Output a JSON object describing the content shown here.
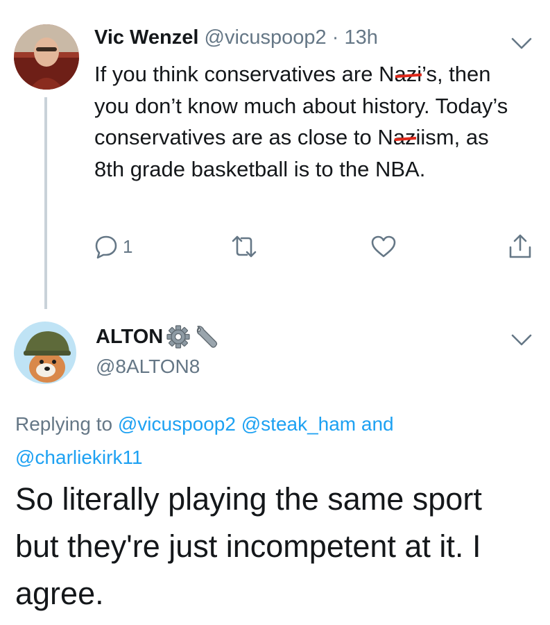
{
  "tweet1": {
    "display_name": "Vic Wenzel",
    "handle": "@vicuspoop2",
    "separator": "·",
    "time": "13h",
    "text_parts": {
      "p1": "If you think conservatives are ",
      "s1": "N",
      "s2": "azi",
      "p2": "’s, then you don’t know much about history. Today’s conservatives are as close to ",
      "s3": "N",
      "s4": "az",
      "p3": "iism, as 8th grade basketball is to the NBA."
    },
    "reply_count": "1"
  },
  "tweet2": {
    "display_name": "ALTON",
    "handle": "@8ALTON8",
    "replying_prefix": "Replying to ",
    "mention1": "@vicuspoop2",
    "mention2": "@steak_ham",
    "and_word": " and",
    "mention3": "@charliekirk11",
    "text": "So literally playing the same sport but they're just incompetent at it. I agree."
  },
  "icons": {
    "reply": "reply-icon",
    "retweet": "retweet-icon",
    "like": "heart-icon",
    "share": "share-icon",
    "caret": "chevron-down-icon",
    "gear": "gear-emoji-icon",
    "wrench": "wrench-emoji-icon"
  },
  "colors": {
    "text": "#14171a",
    "muted": "#657786",
    "link": "#1da1f2",
    "thread": "#c9d2d9",
    "redaction": "#e0291b"
  }
}
